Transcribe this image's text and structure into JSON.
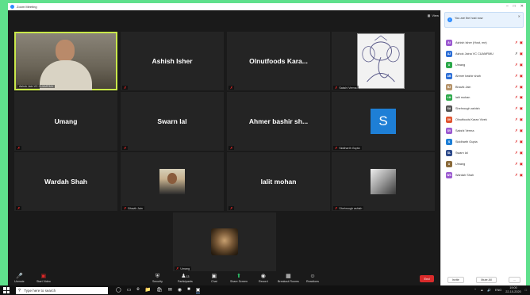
{
  "window": {
    "title": "Zoom Meeting"
  },
  "view_button": "View",
  "tiles": [
    {
      "name": "",
      "label": "Ashok Jain VC CUAMRMU",
      "kind": "video"
    },
    {
      "name": "Ashish Isher",
      "label": "",
      "kind": "name"
    },
    {
      "name": "Olnutfoods Kara...",
      "label": "",
      "kind": "name"
    },
    {
      "name": "",
      "label": "Sakshi Verma",
      "kind": "sketch"
    },
    {
      "name": "Umang",
      "label": "",
      "kind": "name"
    },
    {
      "name": "Swarn lal",
      "label": "",
      "kind": "name"
    },
    {
      "name": "Ahmer bashir sh...",
      "label": "",
      "kind": "name"
    },
    {
      "name": "",
      "label": "Siddharth Gupta",
      "kind": "badge",
      "initial": "S"
    },
    {
      "name": "Wardah Shah",
      "label": "",
      "kind": "name"
    },
    {
      "name": "",
      "label": "Bhavik Jain",
      "kind": "photo-bj"
    },
    {
      "name": "lalit mohan",
      "label": "",
      "kind": "name"
    },
    {
      "name": "",
      "label": "Shehrough ashish",
      "kind": "photo-sa"
    },
    {
      "name": "",
      "label": "Umang",
      "kind": "photo-um"
    }
  ],
  "toolbar": {
    "unmute": "Unmute",
    "start_video": "Start Video",
    "security": "Security",
    "participants": "Participants",
    "participants_count": "13",
    "chat": "Chat",
    "share_screen": "Share Screen",
    "record": "Record",
    "breakout": "Breakout Rooms",
    "reactions": "Reactions",
    "end": "End"
  },
  "panel": {
    "notice": "You are the host now",
    "participants": [
      {
        "initials": "AI",
        "name": "Ashish Isher (Host, me)",
        "color": "#9b59d0",
        "mic_on": false
      },
      {
        "initials": "AJ",
        "name": "Ashok Jaina VC CUAMRMU",
        "color": "#2d6fd6",
        "mic_on": true
      },
      {
        "initials": "U",
        "name": "Umang",
        "color": "#2ca84a",
        "mic_on": false
      },
      {
        "initials": "AB",
        "name": "Ahmer bashir shah",
        "color": "#2d6fd6",
        "mic_on": false
      },
      {
        "initials": "BJ",
        "name": "Bhavik Jain",
        "color": "#b5936a",
        "mic_on": false
      },
      {
        "initials": "LM",
        "name": "lalit mohan",
        "color": "#2ca84a",
        "mic_on": false
      },
      {
        "initials": "SA",
        "name": "Shehrough ashish",
        "color": "#555555",
        "mic_on": false
      },
      {
        "initials": "OK",
        "name": "Olnutfoods Karan Vivek",
        "color": "#e0522d",
        "mic_on": false
      },
      {
        "initials": "SV",
        "name": "Sakshi Verma",
        "color": "#9b59d0",
        "mic_on": false
      },
      {
        "initials": "S",
        "name": "Siddharth Gupta",
        "color": "#1e7fd6",
        "mic_on": false
      },
      {
        "initials": "SL",
        "name": "Swarn lal",
        "color": "#2d4a8a",
        "mic_on": false
      },
      {
        "initials": "U",
        "name": "Umang",
        "color": "#8a6a3a",
        "mic_on": false
      },
      {
        "initials": "WS",
        "name": "Wardah Shah",
        "color": "#9b59d0",
        "mic_on": false
      }
    ],
    "invite": "Invite",
    "mute_all": "Mute All",
    "more": "..."
  },
  "taskbar": {
    "search_placeholder": "Type here to search",
    "lang": "ENG",
    "time": "19:00",
    "date": "22-10-2020"
  }
}
